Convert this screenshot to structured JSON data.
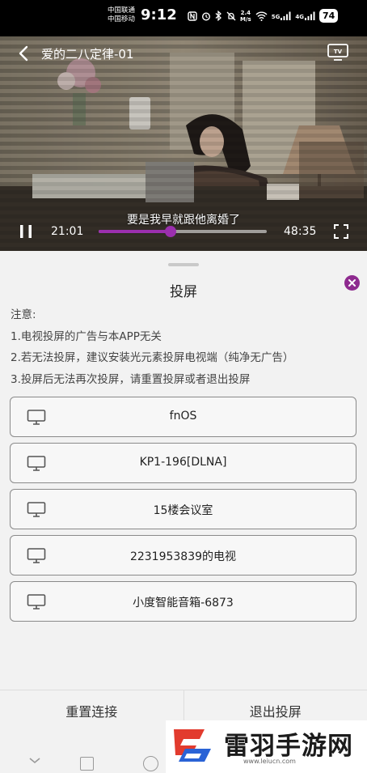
{
  "status_bar": {
    "carrier_1": "中国联通",
    "carrier_2": "中国移动",
    "time": "9:12",
    "net_speed_value": "2.4",
    "net_speed_unit": "M/s",
    "signal_1": "5G",
    "signal_2": "4G",
    "battery": "74"
  },
  "video": {
    "title": "爱的二八定律-01",
    "subtitle": "要是我早就跟他离婚了",
    "current_time": "21:01",
    "total_time": "48:35",
    "progress": 0.43,
    "accent_color": "#9b2fae"
  },
  "cast_sheet": {
    "title": "投屏",
    "notes": [
      "注意:",
      "1.电视投屏的广告与本APP无关",
      "2.若无法投屏，建议安装光元素投屏电视端（纯净无广告）",
      "3.投屏后无法再次投屏，请重置投屏或者退出投屏"
    ],
    "devices": [
      "fnOS",
      "KP1-196[DLNA]",
      "15楼会议室",
      "2231953839的电视",
      "小度智能音箱-6873"
    ],
    "reset_label": "重置连接",
    "exit_label": "退出投屏"
  },
  "watermark": {
    "name": "雷羽手游网",
    "url": "www.leiucn.com"
  },
  "icons": [
    "back-icon",
    "tv-cast-icon",
    "pause-icon",
    "fullscreen-icon",
    "close-icon",
    "screen-icon"
  ]
}
